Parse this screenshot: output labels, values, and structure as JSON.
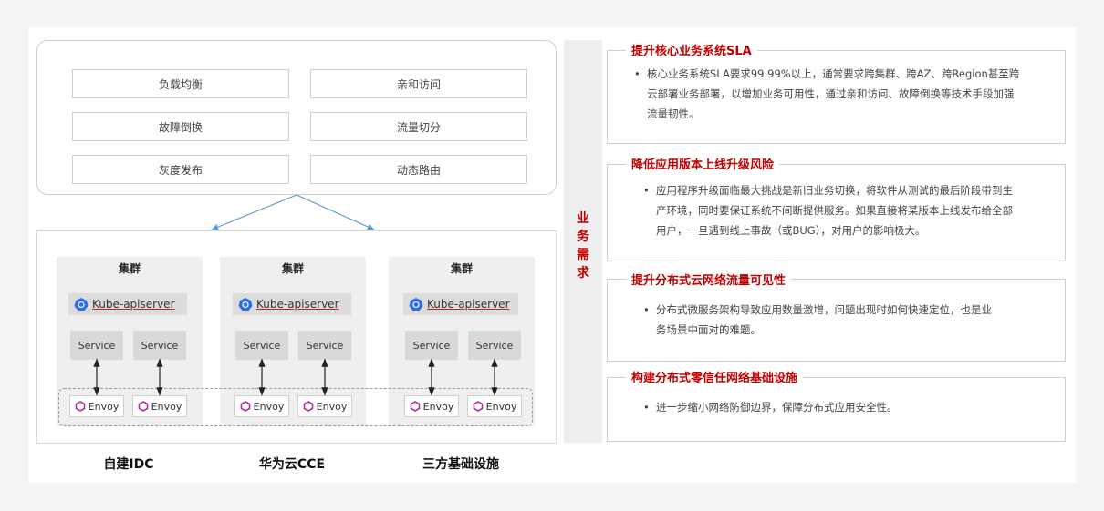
{
  "features": {
    "items": [
      "负载均衡",
      "亲和访问",
      "故障倒换",
      "流量切分",
      "灰度发布",
      "动态路由"
    ]
  },
  "clusters": [
    {
      "title": "集群",
      "apiserver": "Kube-apiserver",
      "services": [
        "Service",
        "Service"
      ],
      "envoys": [
        "Envoy",
        "Envoy"
      ],
      "label": "自建IDC"
    },
    {
      "title": "集群",
      "apiserver": "Kube-apiserver",
      "services": [
        "Service",
        "Service"
      ],
      "envoys": [
        "Envoy",
        "Envoy"
      ],
      "label": "华为云CCE"
    },
    {
      "title": "集群",
      "apiserver": "Kube-apiserver",
      "services": [
        "Service",
        "Service"
      ],
      "envoys": [
        "Envoy",
        "Envoy"
      ],
      "label": "三方基础设施"
    }
  ],
  "divider": {
    "chars": [
      "业",
      "务",
      "需",
      "求"
    ]
  },
  "requirements": [
    {
      "title": "提升核心业务系统SLA",
      "lines": [
        "核心业务系统SLA要求99.99%以上，通常要求跨集群、跨AZ、跨Region甚至跨",
        "云部署业务部署，以增加业务可用性，通过亲和访问、故障倒换等技术手段加强",
        "流量韧性。"
      ]
    },
    {
      "title": "降低应用版本上线升级风险",
      "lines": [
        "应用程序升级面临最大挑战是新旧业务切换，将软件从测试的最后阶段带到生",
        "产环境，同时要保证系统不间断提供服务。如果直接将某版本上线发布给全部",
        "用户，一旦遇到线上事故（或BUG），对用户的影响极大。"
      ]
    },
    {
      "title": "提升分布式云网络流量可见性",
      "lines": [
        "分布式微服务架构导致应用数量激增，问题出现时如何快速定位，也是业",
        "务场景中面对的难题。"
      ]
    },
    {
      "title": "构建分布式零信任网络基础设施",
      "lines": [
        "进一步缩小网络防御边界，保障分布式应用安全性。"
      ]
    }
  ],
  "colors": {
    "accent": "#c00000",
    "arrow": "#5b9bd5",
    "envoy_icon": "#b0309b",
    "kube_icon": "#326ce5"
  }
}
